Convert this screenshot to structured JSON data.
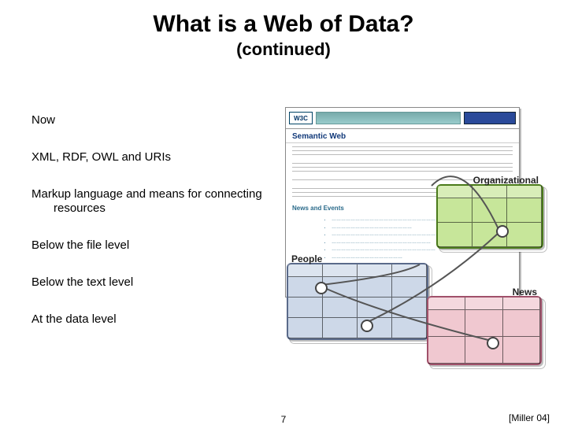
{
  "title": "What is a Web of Data?",
  "subtitle": "(continued)",
  "bullets": {
    "b1": "Now",
    "b2": "XML, RDF, OWL and URIs",
    "b3": "Markup language and means for connecting resources",
    "b4": "Below the file level",
    "b5": "Below the text level",
    "b6": "At the data level"
  },
  "figure": {
    "browser_logo": "W3C",
    "browser_title": "Semantic Web",
    "section_news": "News and Events",
    "cards": {
      "org": "Organizational",
      "people": "People",
      "news": "News"
    }
  },
  "citation": "[Miller 04]",
  "page_number": "7"
}
